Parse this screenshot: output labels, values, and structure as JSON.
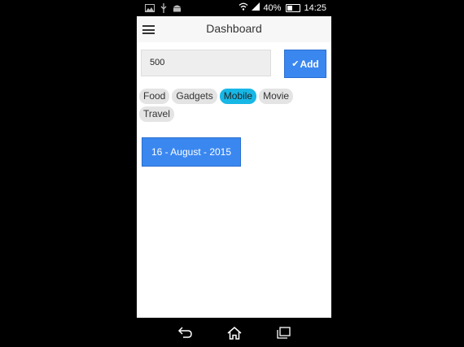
{
  "status_bar": {
    "battery_percent": "40%",
    "time": "14:25",
    "left_icons": [
      "image-icon",
      "usb-icon",
      "android-icon"
    ],
    "right_icons": [
      "wifi-icon",
      "signal-icon",
      "battery-icon"
    ]
  },
  "appbar": {
    "title": "Dashboard"
  },
  "amount_input": {
    "value": "500"
  },
  "add_button": {
    "label": "Add"
  },
  "tags": [
    {
      "label": "Food",
      "selected": false
    },
    {
      "label": "Gadgets",
      "selected": false
    },
    {
      "label": "Mobile",
      "selected": true
    },
    {
      "label": "Movie",
      "selected": false
    },
    {
      "label": "Travel",
      "selected": false
    }
  ],
  "date_button": {
    "label": "16 - August - 2015"
  },
  "nav_bar": {
    "buttons": [
      "back-icon",
      "home-icon",
      "recent-apps-icon"
    ]
  },
  "colors": {
    "accent": "#3a87f0",
    "selected_tag": "#17b7e6"
  }
}
